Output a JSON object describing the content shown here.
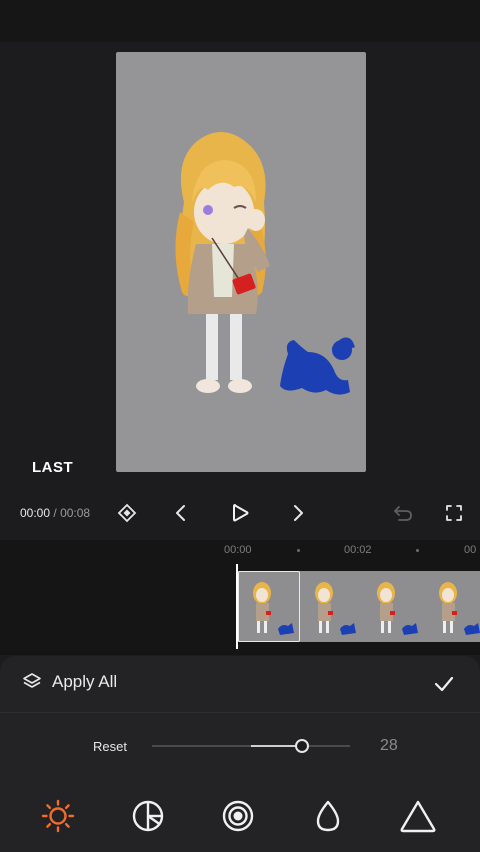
{
  "preview": {
    "watermark": "LAST"
  },
  "playback": {
    "current_time": "00:00",
    "separator": "/",
    "duration": "00:08"
  },
  "timeline": {
    "ruler_labels": [
      "00:00",
      "00:02",
      "00"
    ]
  },
  "panel": {
    "apply_all_label": "Apply All",
    "reset_label": "Reset",
    "slider_value": "28",
    "slider_fraction": 0.75,
    "tools": [
      "brightness-icon",
      "contrast-icon",
      "saturation-icon",
      "exposure-icon",
      "sharpen-icon"
    ],
    "active_tool": "brightness-icon"
  },
  "colors": {
    "accent": "#f36c2b",
    "background": "#1c1c1e",
    "panel": "#232325"
  }
}
